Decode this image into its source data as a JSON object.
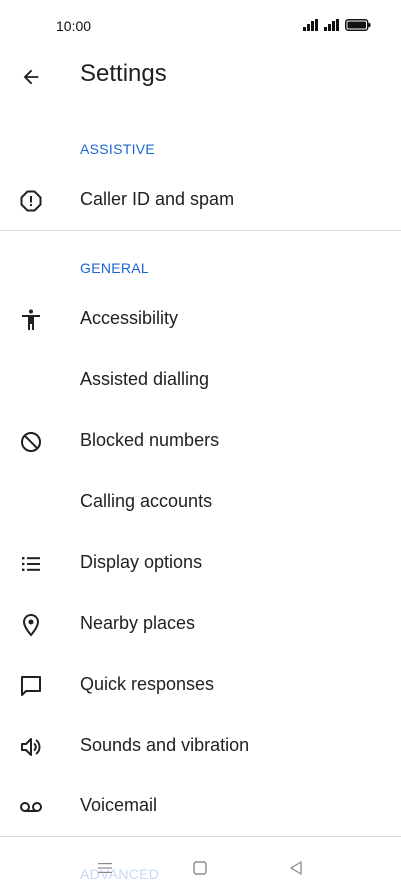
{
  "status_bar": {
    "time": "10:00",
    "icons": [
      "signal-icon",
      "signal-icon",
      "battery-icon"
    ]
  },
  "app_bar": {
    "title": "Settings",
    "back_icon": "arrow-back-icon"
  },
  "sections": {
    "assistive": {
      "header": "ASSISTIVE",
      "items": [
        {
          "label": "Caller ID and spam",
          "icon": "alert-circle-icon"
        }
      ]
    },
    "general": {
      "header": "GENERAL",
      "items": [
        {
          "label": "Accessibility",
          "icon": "accessibility-icon"
        },
        {
          "label": "Assisted dialling",
          "icon": ""
        },
        {
          "label": "Blocked numbers",
          "icon": "block-icon"
        },
        {
          "label": "Calling accounts",
          "icon": ""
        },
        {
          "label": "Display options",
          "icon": "list-icon"
        },
        {
          "label": "Nearby places",
          "icon": "location-pin-icon"
        },
        {
          "label": "Quick responses",
          "icon": "chat-bubble-icon"
        },
        {
          "label": "Sounds and vibration",
          "icon": "volume-icon"
        },
        {
          "label": "Voicemail",
          "icon": "voicemail-icon"
        }
      ]
    },
    "advanced": {
      "header": "ADVANCED"
    }
  },
  "nav_bar": {
    "icons": [
      "menu-icon",
      "home-square-icon",
      "back-triangle-icon"
    ]
  },
  "colors": {
    "accent": "#1a66d0",
    "text": "#202124",
    "divider": "#dadce0"
  }
}
